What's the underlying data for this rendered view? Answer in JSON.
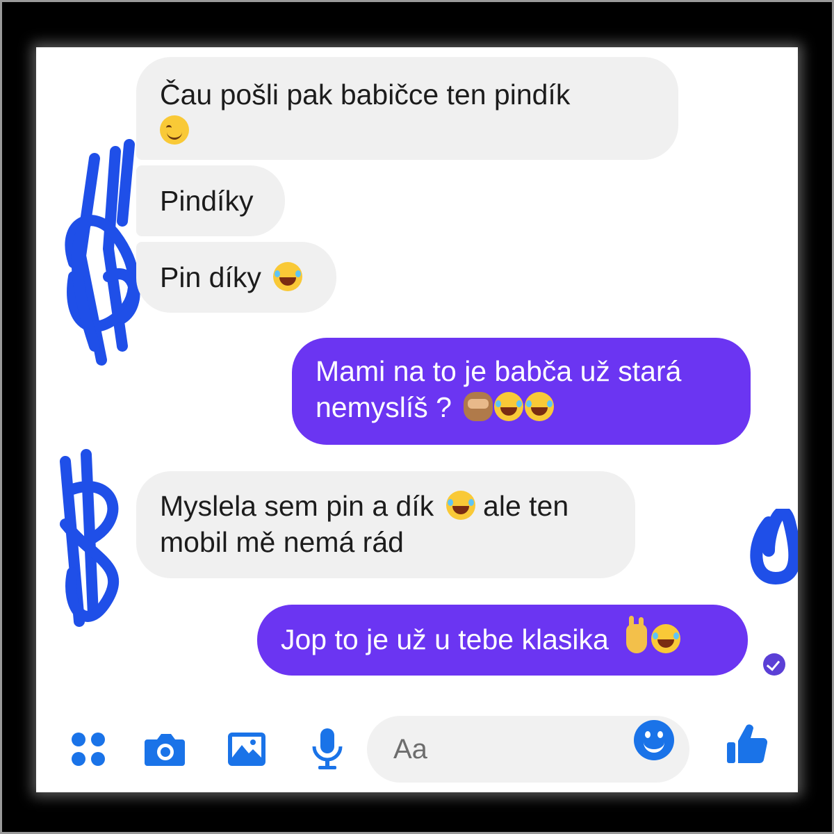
{
  "messages": [
    {
      "direction": "incoming",
      "lines": [
        "Čau pošli pak babičce ten pindík",
        ""
      ],
      "emoji": [
        "smiling-face-icon"
      ]
    },
    {
      "direction": "incoming",
      "lines": [
        "Pindíky"
      ]
    },
    {
      "direction": "incoming",
      "lines": [
        "Pin díky"
      ],
      "emoji": [
        "tears-of-joy-icon"
      ]
    },
    {
      "direction": "outgoing",
      "lines": [
        "Mami na to je babča už stará",
        "nemyslíš  ?"
      ],
      "emoji": [
        "see-no-evil-monkey-icon",
        "rolling-laughing-icon",
        "rolling-laughing-icon"
      ]
    },
    {
      "direction": "incoming",
      "lines": [
        "Myslela sem pin a dík",
        "ale ten",
        "mobil mě nemá rád"
      ],
      "emoji": [
        "grinning-sweat-icon"
      ]
    },
    {
      "direction": "outgoing",
      "lines": [
        "Jop to je už u tebe klasika"
      ],
      "emoji": [
        "victory-hand-icon",
        "tears-of-joy-icon"
      ]
    }
  ],
  "composer": {
    "placeholder": "Aa",
    "icons": [
      "menu-dots-icon",
      "camera-icon",
      "gallery-icon",
      "microphone-icon",
      "emoji-icon",
      "thumbs-up-icon"
    ]
  },
  "colors": {
    "outgoing_bubble": "#6b35f2",
    "incoming_bubble": "#f0f0f0",
    "accent": "#1a73e8",
    "scribble": "#1f4fe8"
  }
}
